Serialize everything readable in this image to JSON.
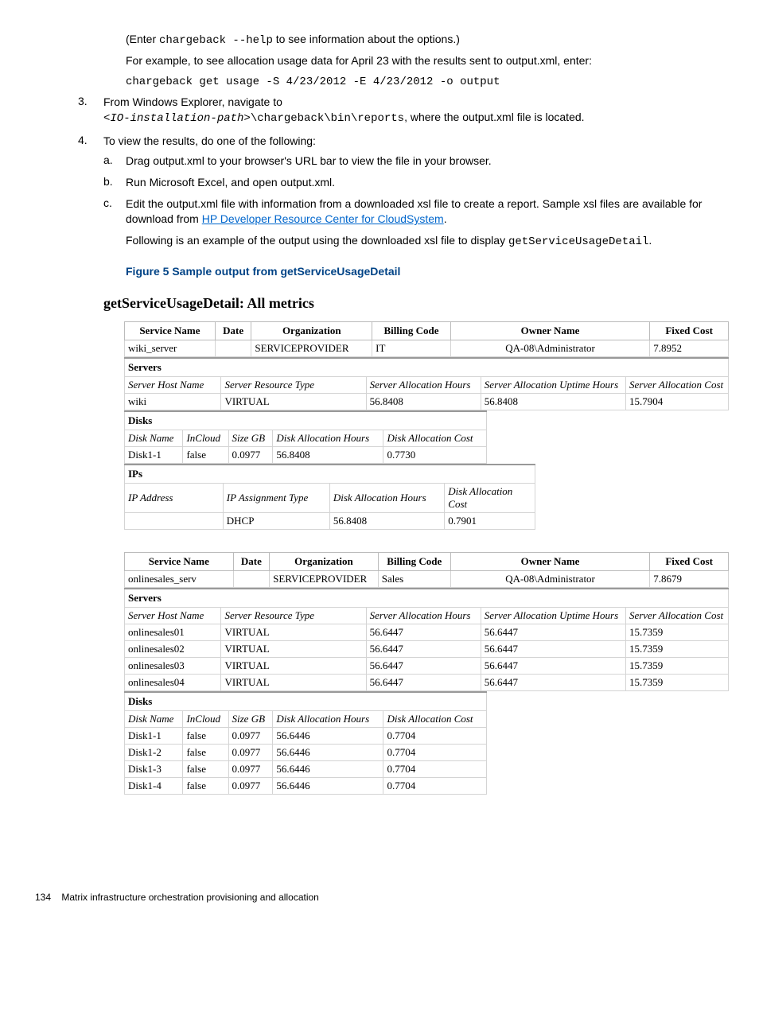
{
  "intro": {
    "p1a": "(Enter ",
    "p1_code": "chargeback --help",
    "p1b": " to see information about the options.)",
    "p2": "For example, to see allocation usage data for April 23 with the results sent to output.xml, enter:",
    "p3_code": "chargeback get usage -S 4/23/2012 -E 4/23/2012 -o output"
  },
  "step3": {
    "num": "3.",
    "text_a": "From Windows Explorer, navigate to",
    "code": "<IO-installation-path>",
    "code_b": "\\chargeback\\bin\\reports",
    "text_b": ", where the output.xml file is located."
  },
  "step4": {
    "num": "4.",
    "lead": "To view the results, do one of the following:",
    "a_label": "a.",
    "a_text": "Drag output.xml to your browser's URL bar to view the file in your browser.",
    "b_label": "b.",
    "b_text": "Run Microsoft Excel, and open output.xml.",
    "c_label": "c.",
    "c_text_a": "Edit the output.xml file with information from a downloaded xsl file to create a report. Sample xsl files are available for download from ",
    "c_link": "HP Developer Resource Center for CloudSystem",
    "c_text_b": ".",
    "c_p2_a": "Following is an example of the output using the downloaded xsl file to display ",
    "c_p2_code": "getServiceUsageDetail",
    "c_p2_b": "."
  },
  "figure_caption": "Figure 5 Sample output from getServiceUsageDetail",
  "figure_title": "getServiceUsageDetail: All metrics",
  "headers": {
    "service_name": "Service Name",
    "date": "Date",
    "organization": "Organization",
    "billing_code": "Billing Code",
    "owner_name": "Owner Name",
    "fixed_cost": "Fixed Cost",
    "servers": "Servers",
    "server_host_name": "Server Host Name",
    "server_resource_type": "Server Resource Type",
    "server_alloc_hours": "Server Allocation Hours",
    "server_alloc_uptime": "Server Allocation Uptime Hours",
    "server_alloc_cost": "Server Allocation Cost",
    "disks": "Disks",
    "disk_name": "Disk Name",
    "incloud": "InCloud",
    "size_gb": "Size GB",
    "disk_alloc_hours": "Disk Allocation Hours",
    "disk_alloc_cost": "Disk Allocation Cost",
    "ips": "IPs",
    "ip_address": "IP Address",
    "ip_assign_type": "IP Assignment Type"
  },
  "chart_data": {
    "type": "table",
    "services": [
      {
        "service_name": "wiki_server",
        "date": "",
        "organization": "SERVICEPROVIDER",
        "billing_code": "IT",
        "owner_name": "QA-08\\Administrator",
        "fixed_cost": "7.8952",
        "servers": [
          {
            "host_name": "wiki",
            "resource_type": "VIRTUAL",
            "alloc_hours": "56.8408",
            "alloc_uptime_hours": "56.8408",
            "alloc_cost": "15.7904"
          }
        ],
        "disks": [
          {
            "name": "Disk1-1",
            "incloud": "false",
            "size_gb": "0.0977",
            "alloc_hours": "56.8408",
            "alloc_cost": "0.7730"
          }
        ],
        "ips": [
          {
            "ip_address": "",
            "assignment_type": "DHCP",
            "alloc_hours": "56.8408",
            "alloc_cost": "0.7901"
          }
        ]
      },
      {
        "service_name": "onlinesales_serv",
        "date": "",
        "organization": "SERVICEPROVIDER",
        "billing_code": "Sales",
        "owner_name": "QA-08\\Administrator",
        "fixed_cost": "7.8679",
        "servers": [
          {
            "host_name": "onlinesales01",
            "resource_type": "VIRTUAL",
            "alloc_hours": "56.6447",
            "alloc_uptime_hours": "56.6447",
            "alloc_cost": "15.7359"
          },
          {
            "host_name": "onlinesales02",
            "resource_type": "VIRTUAL",
            "alloc_hours": "56.6447",
            "alloc_uptime_hours": "56.6447",
            "alloc_cost": "15.7359"
          },
          {
            "host_name": "onlinesales03",
            "resource_type": "VIRTUAL",
            "alloc_hours": "56.6447",
            "alloc_uptime_hours": "56.6447",
            "alloc_cost": "15.7359"
          },
          {
            "host_name": "onlinesales04",
            "resource_type": "VIRTUAL",
            "alloc_hours": "56.6447",
            "alloc_uptime_hours": "56.6447",
            "alloc_cost": "15.7359"
          }
        ],
        "disks": [
          {
            "name": "Disk1-1",
            "incloud": "false",
            "size_gb": "0.0977",
            "alloc_hours": "56.6446",
            "alloc_cost": "0.7704"
          },
          {
            "name": "Disk1-2",
            "incloud": "false",
            "size_gb": "0.0977",
            "alloc_hours": "56.6446",
            "alloc_cost": "0.7704"
          },
          {
            "name": "Disk1-3",
            "incloud": "false",
            "size_gb": "0.0977",
            "alloc_hours": "56.6446",
            "alloc_cost": "0.7704"
          },
          {
            "name": "Disk1-4",
            "incloud": "false",
            "size_gb": "0.0977",
            "alloc_hours": "56.6446",
            "alloc_cost": "0.7704"
          }
        ]
      }
    ]
  },
  "footer": {
    "page": "134",
    "text": "Matrix infrastructure orchestration provisioning and allocation"
  }
}
